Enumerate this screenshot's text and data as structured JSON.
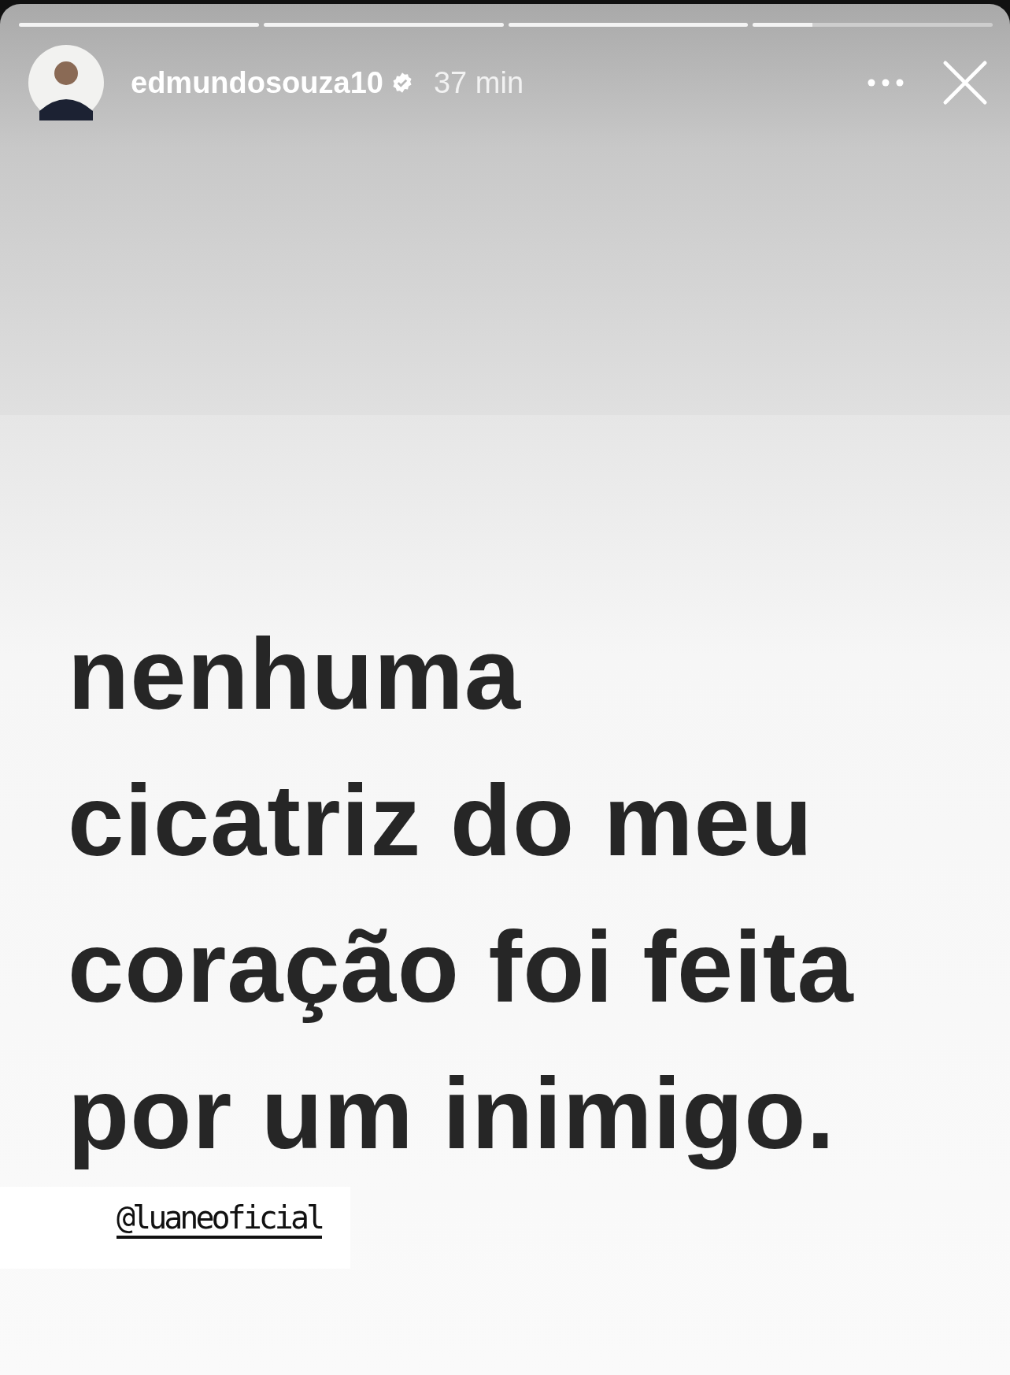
{
  "progress": [
    {
      "level": 1
    },
    {
      "level": 1
    },
    {
      "level": 1
    },
    {
      "level": 0.25
    }
  ],
  "header": {
    "username": "edmundosouza10",
    "verified": true,
    "time": "37 min"
  },
  "post": {
    "lines": [
      "nenhuma",
      "cicatriz do meu",
      "coração foi feita",
      "por um inimigo."
    ],
    "mention": "@luaneoficial"
  }
}
